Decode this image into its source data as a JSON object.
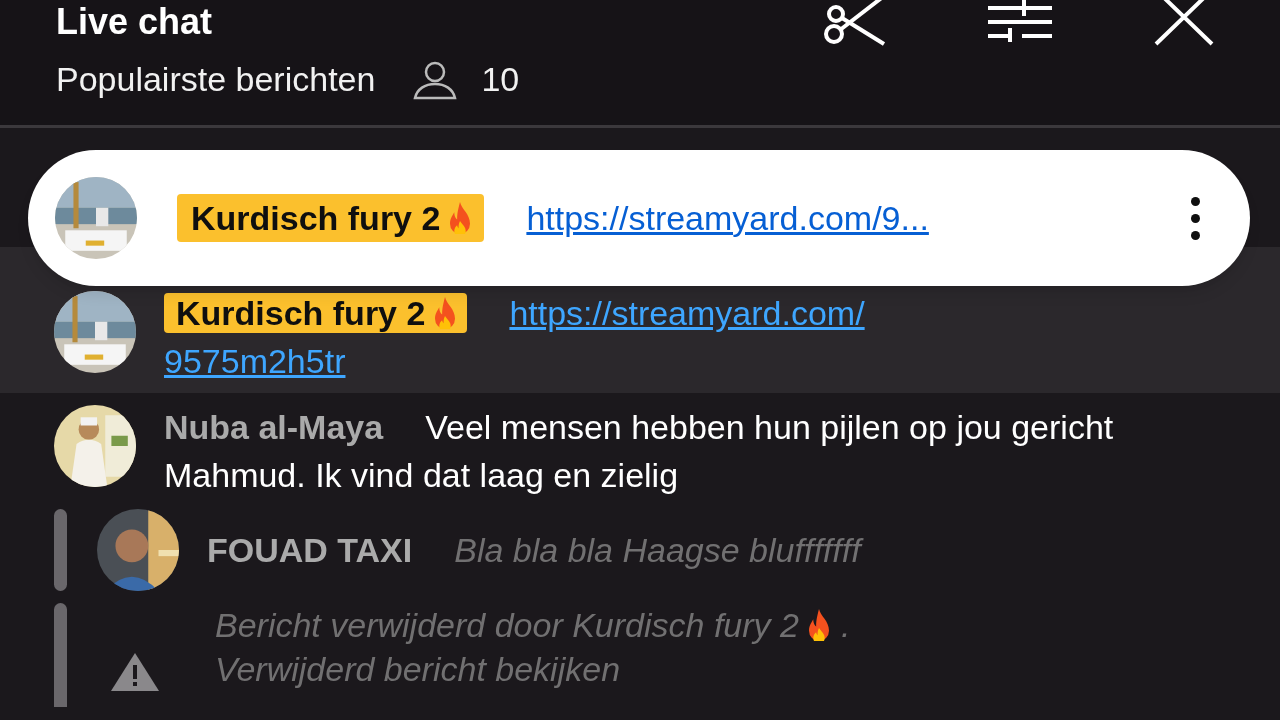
{
  "header": {
    "title": "Live chat",
    "subtitle": "Populairste berichten",
    "viewers": "10"
  },
  "pinned": {
    "author": "Kurdisch fury 2",
    "link": "https://streamyard.com/9..."
  },
  "messages": [
    {
      "kind": "message",
      "highlighted": true,
      "owner": true,
      "author": "Kurdisch fury 2",
      "link_lines": [
        "https://streamyard.com/",
        "9575m2h5tr"
      ]
    },
    {
      "kind": "message",
      "highlighted": false,
      "owner": false,
      "author": "Nuba al-Maya",
      "text": "Veel mensen hebben hun pijlen op jou gericht Mahmud. Ik vind dat laag en zielig"
    },
    {
      "kind": "reply",
      "author": "FOUAD TAXI",
      "text": "Bla bla bla Haagse blufffffff"
    },
    {
      "kind": "deleted",
      "text": "Bericht verwijderd door Kurdisch fury 2",
      "suffix": ".",
      "action": "Verwijderd bericht bekijken"
    }
  ]
}
